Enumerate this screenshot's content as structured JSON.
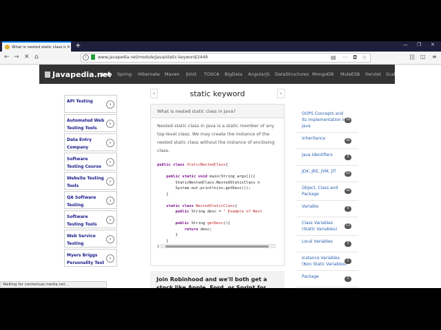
{
  "browser": {
    "tab_title": "What is nested static class in Ja",
    "url": "www.javapedia.net/module/Java/static-keyword/2449",
    "status": "Waiting for contextual.media.net..."
  },
  "site": {
    "logo": "Javapedia.net",
    "nav": [
      "Java",
      "Spring",
      "Hibernate",
      "Maven",
      "JUnit",
      "TOSCA",
      "BigData",
      "AngularJS",
      "DataStructures",
      "MongoDB",
      "MuleESB",
      "Servlet",
      "Scala"
    ]
  },
  "ads": [
    "API Testing",
    "Automated Web Testing Tools",
    "Data Entry Company",
    "Software Testing Course",
    "Website Testing Tools",
    "QA Software Testing",
    "Software Testing Tools",
    "Web Service Testing",
    "Myers Briggs Personality Test"
  ],
  "content": {
    "prev": "«",
    "next": "»",
    "title": "static keyword",
    "question": "What is nested static class in Java?",
    "answer": "Nested static class in Java is a static member of any top-level class. We may create the instance of the nested static class without the instance of enclosing class."
  },
  "code_lines": [
    {
      "segments": [
        [
          "kw",
          "public class "
        ],
        [
          "cls",
          "StaticNestedClass"
        ],
        [
          "plain",
          "{"
        ]
      ]
    },
    {
      "segments": [
        [
          "plain",
          ""
        ]
      ]
    },
    {
      "segments": [
        [
          "plain",
          "    "
        ],
        [
          "kw",
          "public static void "
        ],
        [
          "plain",
          "main(String args[]){"
        ]
      ]
    },
    {
      "segments": [
        [
          "plain",
          "        StaticNestedClass.NestedStaticClass n"
        ]
      ]
    },
    {
      "segments": [
        [
          "plain",
          "        System.out.println(ns.getDesc());"
        ]
      ]
    },
    {
      "segments": [
        [
          "plain",
          "    }"
        ]
      ]
    },
    {
      "segments": [
        [
          "plain",
          ""
        ]
      ]
    },
    {
      "segments": [
        [
          "plain",
          "    "
        ],
        [
          "kw",
          "static class "
        ],
        [
          "cls",
          "NestedStaticClass"
        ],
        [
          "plain",
          "{"
        ]
      ]
    },
    {
      "segments": [
        [
          "plain",
          "        "
        ],
        [
          "kw",
          "public "
        ],
        [
          "plain",
          "String desc = "
        ],
        [
          "cls",
          "\" Example of Nest"
        ]
      ]
    },
    {
      "segments": [
        [
          "plain",
          ""
        ]
      ]
    },
    {
      "segments": [
        [
          "plain",
          "        "
        ],
        [
          "kw",
          "public "
        ],
        [
          "plain",
          "String "
        ],
        [
          "cls",
          "getDesc"
        ],
        [
          "plain",
          "(){"
        ]
      ]
    },
    {
      "segments": [
        [
          "plain",
          "            "
        ],
        [
          "kw",
          "return "
        ],
        [
          "plain",
          "desc;"
        ]
      ]
    },
    {
      "segments": [
        [
          "plain",
          "        }"
        ]
      ]
    },
    {
      "segments": [
        [
          "plain",
          "    }"
        ]
      ]
    },
    {
      "segments": [
        [
          "plain",
          "}"
        ]
      ]
    }
  ],
  "promo": {
    "text": "Join Robinhood and we'll both get a stock like Apple, Ford, or Sprint for free."
  },
  "topics": [
    {
      "label": "OOPS Concepts and its implementation in Java",
      "count": "18"
    },
    {
      "label": "Inheritance",
      "count": "28"
    },
    {
      "label": "Java Identifiers",
      "count": "4"
    },
    {
      "label": "JDK, JRE, JVM, JIT",
      "count": "65"
    },
    {
      "label": "Object, Class and Package",
      "count": "44"
    },
    {
      "label": "Variable",
      "count": "9"
    },
    {
      "label": "Class Variables (Static Variables)",
      "count": "13"
    },
    {
      "label": "Local Variables",
      "count": "5"
    },
    {
      "label": "Instance Variables (Non Static Variables)",
      "count": "2"
    },
    {
      "label": "Package",
      "count": "5"
    }
  ]
}
